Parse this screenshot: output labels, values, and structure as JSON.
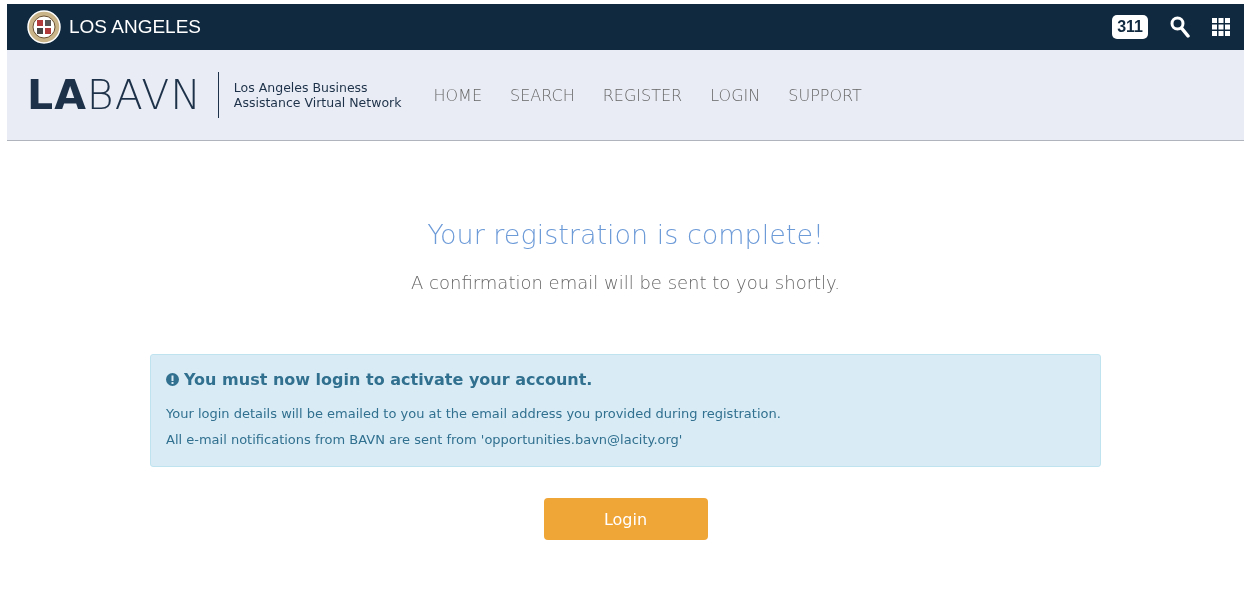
{
  "city_bar": {
    "title": "LOS ANGELES",
    "badge": "311"
  },
  "header": {
    "logo": "**LA**BAVN",
    "tagline": [
      "Los Angeles Business",
      "Assistance Virtual Network"
    ],
    "nav": [
      {
        "label": "HOME"
      },
      {
        "label": "SEARCH"
      },
      {
        "label": "REGISTER"
      },
      {
        "label": "LOGIN"
      },
      {
        "label": "SUPPORT"
      }
    ]
  },
  "main": {
    "heading": "Your registration is complete!",
    "subheading": "A confirmation email will be sent to you shortly.",
    "alert": {
      "title": "You must now login to activate your account.",
      "lines": [
        "Your login details will be emailed to you at the email address you provided during registration.",
        "All e-mail notifications from BAVN are sent from 'opportunities.bavn@lacity.org'"
      ]
    },
    "button": "Login"
  }
}
